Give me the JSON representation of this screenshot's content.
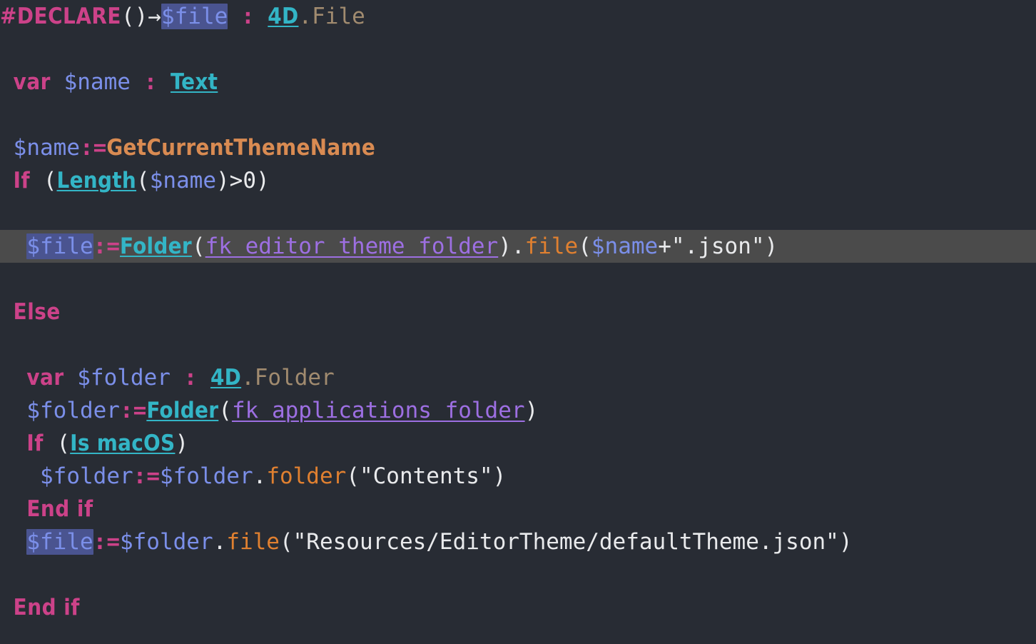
{
  "editor": {
    "language": "4D",
    "theme_name": "Dark",
    "background_color": "#282c34",
    "current_line_color": "#4b4b4b",
    "selection_color": "#4a5490",
    "colors": {
      "keyword": "#cc4289",
      "variable": "#7b8fe9",
      "type": "#33b5c6",
      "property": "#a18b6f",
      "method": "#d98b52",
      "member_function": "#e08030",
      "constant": "#9d6fe2",
      "punctuation": "#e9eaec"
    },
    "current_line_number": 7,
    "lines": [
      {
        "n": 1,
        "text": "#DECLARE()->$file : 4D.File",
        "indent": "",
        "current": false,
        "tokens": [
          {
            "k": "kw",
            "v": "#DECLARE"
          },
          {
            "k": "punct",
            "v": "()"
          },
          {
            "k": "arrow",
            "v": "→"
          },
          {
            "k": "var",
            "v": "$file",
            "sel": true
          },
          {
            "k": "punct",
            "v": " "
          },
          {
            "k": "colon",
            "v": ":"
          },
          {
            "k": "punct",
            "v": " "
          },
          {
            "k": "type",
            "v": "4D"
          },
          {
            "k": "prop",
            "v": ".File"
          }
        ]
      },
      {
        "n": 2,
        "text": "",
        "indent": "",
        "current": false,
        "tokens": []
      },
      {
        "n": 3,
        "text": " var $name : Text",
        "indent": " ",
        "current": false,
        "tokens": [
          {
            "k": "kw",
            "v": "var"
          },
          {
            "k": "punct",
            "v": " "
          },
          {
            "k": "var",
            "v": "$name"
          },
          {
            "k": "punct",
            "v": " "
          },
          {
            "k": "colon",
            "v": ":"
          },
          {
            "k": "punct",
            "v": " "
          },
          {
            "k": "type",
            "v": "Text"
          }
        ]
      },
      {
        "n": 4,
        "text": "",
        "indent": "",
        "current": false,
        "tokens": []
      },
      {
        "n": 5,
        "text": " $name:=GetCurrentThemeName",
        "indent": " ",
        "current": false,
        "tokens": [
          {
            "k": "var",
            "v": "$name"
          },
          {
            "k": "colon",
            "v": ":="
          },
          {
            "k": "method",
            "v": "GetCurrentThemeName"
          }
        ]
      },
      {
        "n": 6,
        "text": " If (Length($name)>0)",
        "indent": " ",
        "current": false,
        "tokens": [
          {
            "k": "kw",
            "v": "If"
          },
          {
            "k": "punct",
            "v": " ("
          },
          {
            "k": "type",
            "v": "Length"
          },
          {
            "k": "punct",
            "v": "("
          },
          {
            "k": "var",
            "v": "$name"
          },
          {
            "k": "punct",
            "v": ")>0)"
          }
        ]
      },
      {
        "n": 7,
        "text": "",
        "indent": "",
        "current": false,
        "tokens": []
      },
      {
        "n": 8,
        "text": "  $file:=Folder(fk editor theme folder).file($name+\".json\")",
        "indent": "  ",
        "current": true,
        "tokens": [
          {
            "k": "var",
            "v": "$file",
            "sel": true
          },
          {
            "k": "colon",
            "v": ":="
          },
          {
            "k": "type",
            "v": "Folder"
          },
          {
            "k": "punct",
            "v": "("
          },
          {
            "k": "const",
            "v": "fk editor theme folder"
          },
          {
            "k": "punct",
            "v": ")."
          },
          {
            "k": "member",
            "v": "file"
          },
          {
            "k": "punct",
            "v": "("
          },
          {
            "k": "var",
            "v": "$name"
          },
          {
            "k": "punct",
            "v": "+\".json\")"
          }
        ]
      },
      {
        "n": 9,
        "text": "",
        "indent": "",
        "current": false,
        "tokens": []
      },
      {
        "n": 10,
        "text": " Else",
        "indent": " ",
        "current": false,
        "tokens": [
          {
            "k": "kw",
            "v": "Else"
          }
        ]
      },
      {
        "n": 11,
        "text": "",
        "indent": "",
        "current": false,
        "tokens": []
      },
      {
        "n": 12,
        "text": "  var $folder : 4D.Folder",
        "indent": "  ",
        "current": false,
        "tokens": [
          {
            "k": "kw",
            "v": "var"
          },
          {
            "k": "punct",
            "v": " "
          },
          {
            "k": "var",
            "v": "$folder"
          },
          {
            "k": "punct",
            "v": " "
          },
          {
            "k": "colon",
            "v": ":"
          },
          {
            "k": "punct",
            "v": " "
          },
          {
            "k": "type",
            "v": "4D"
          },
          {
            "k": "prop",
            "v": ".Folder"
          }
        ]
      },
      {
        "n": 13,
        "text": "  $folder:=Folder(fk applications folder)",
        "indent": "  ",
        "current": false,
        "tokens": [
          {
            "k": "var",
            "v": "$folder"
          },
          {
            "k": "colon",
            "v": ":="
          },
          {
            "k": "type",
            "v": "Folder"
          },
          {
            "k": "punct",
            "v": "("
          },
          {
            "k": "const",
            "v": "fk applications folder"
          },
          {
            "k": "punct",
            "v": ")"
          }
        ]
      },
      {
        "n": 14,
        "text": "  If (Is macOS)",
        "indent": "  ",
        "current": false,
        "tokens": [
          {
            "k": "kw",
            "v": "If"
          },
          {
            "k": "punct",
            "v": " ("
          },
          {
            "k": "type",
            "v": "Is macOS"
          },
          {
            "k": "punct",
            "v": ")"
          }
        ]
      },
      {
        "n": 15,
        "text": "   $folder:=$folder.folder(\"Contents\")",
        "indent": "   ",
        "current": false,
        "tokens": [
          {
            "k": "var",
            "v": "$folder"
          },
          {
            "k": "colon",
            "v": ":="
          },
          {
            "k": "var",
            "v": "$folder"
          },
          {
            "k": "punct",
            "v": "."
          },
          {
            "k": "member",
            "v": "folder"
          },
          {
            "k": "punct",
            "v": "(\"Contents\")"
          }
        ]
      },
      {
        "n": 16,
        "text": "  End if",
        "indent": "  ",
        "current": false,
        "tokens": [
          {
            "k": "kw",
            "v": "End if"
          }
        ]
      },
      {
        "n": 17,
        "text": "  $file:=$folder.file(\"Resources/EditorTheme/defaultTheme.json\")",
        "indent": "  ",
        "current": false,
        "tokens": [
          {
            "k": "var",
            "v": "$file",
            "sel": true
          },
          {
            "k": "colon",
            "v": ":="
          },
          {
            "k": "var",
            "v": "$folder"
          },
          {
            "k": "punct",
            "v": "."
          },
          {
            "k": "member",
            "v": "file"
          },
          {
            "k": "punct",
            "v": "(\"Resources/EditorTheme/defaultTheme.json\")"
          }
        ]
      },
      {
        "n": 18,
        "text": "",
        "indent": "",
        "current": false,
        "tokens": []
      },
      {
        "n": 19,
        "text": " End if",
        "indent": " ",
        "current": false,
        "tokens": [
          {
            "k": "kw",
            "v": "End if"
          }
        ]
      }
    ]
  }
}
